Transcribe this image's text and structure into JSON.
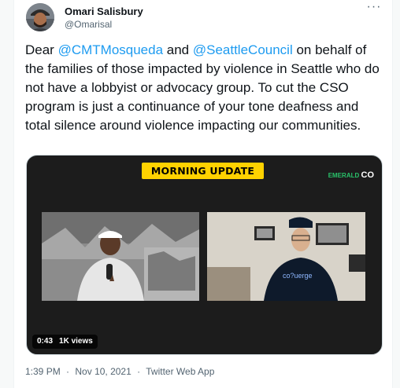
{
  "author": {
    "name": "Omari Salisbury",
    "handle": "@Omarisal"
  },
  "more_glyph": "···",
  "tweet": {
    "part1": "Dear ",
    "mention1": "@CMTMosqueda",
    "part2": " and ",
    "mention2": "@SeattleCouncil",
    "part3": " on behalf of the families of those impacted by violence in Seattle who do not have a lobbyist or advocacy group. To cut the CSO program is just a continuance of your tone deafness and total silence around violence impacting our communities."
  },
  "media": {
    "banner": "MORNING UPDATE",
    "brand_small": "EMERALD",
    "brand_mark": "CO",
    "duration": "0:43",
    "views": "1K views",
    "right_shirt_text": "co?uerge"
  },
  "meta": {
    "time": "1:39 PM",
    "date": "Nov 10, 2021",
    "source": "Twitter Web App",
    "dot": "·"
  },
  "colors": {
    "link": "#1d9bf0",
    "banner": "#ffd200",
    "brand": "#29c26a"
  }
}
